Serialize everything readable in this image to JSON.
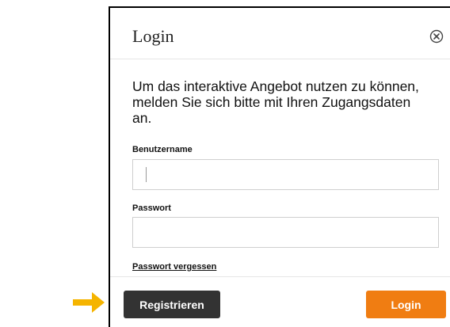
{
  "dialog": {
    "title": "Login",
    "intro_text": "Um das interaktive Angebot nutzen zu können, melden Sie sich bitte mit Ihren Zugangsdaten an.",
    "username": {
      "label": "Benutzername",
      "value": ""
    },
    "password": {
      "label": "Passwort",
      "value": ""
    },
    "forgot_password_link": "Passwort vergessen",
    "buttons": {
      "register": "Registrieren",
      "login": "Login"
    }
  },
  "annotation": {
    "icon": "arrow-right-icon"
  },
  "icons": {
    "close": "close-circle-icon"
  },
  "colors": {
    "login_button": "#f07d12",
    "register_button": "#333333",
    "arrow": "#f5b400"
  }
}
